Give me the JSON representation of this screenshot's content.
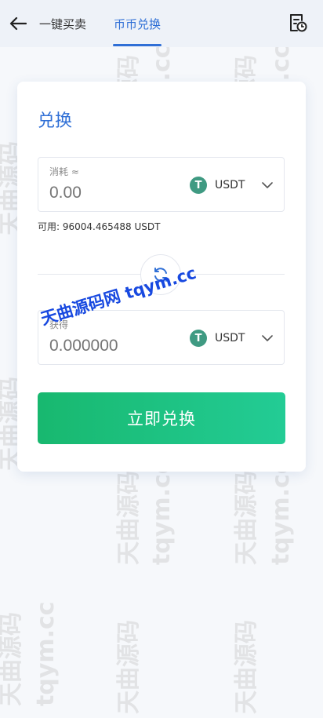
{
  "header": {
    "tabs": [
      {
        "label": "一键买卖",
        "active": false
      },
      {
        "label": "币币兑换",
        "active": true
      }
    ]
  },
  "card": {
    "title": "兑换",
    "pay": {
      "label": "消耗 ≈",
      "value": "0.00",
      "coin": "USDT",
      "coin_icon_glyph": "T"
    },
    "available": "可用: 96004.465488 USDT",
    "receive": {
      "label": "获得",
      "value": "0.000000",
      "coin": "USDT",
      "coin_icon_glyph": "T"
    },
    "submit_label": "立即兑换"
  },
  "watermark": {
    "overlay_text": "天曲源码网 tqym.cc",
    "tile_text_cn": "天曲源码",
    "tile_text_en": "tqym.cc"
  },
  "colors": {
    "accent": "#2f6fd6",
    "button_start": "#18b86f",
    "button_end": "#23cc95",
    "usdt": "#3f9a82"
  },
  "icons": {
    "back": "arrow-left-icon",
    "records": "document-list-icon",
    "swap": "refresh-icon",
    "dropdown": "chevron-down-icon"
  }
}
